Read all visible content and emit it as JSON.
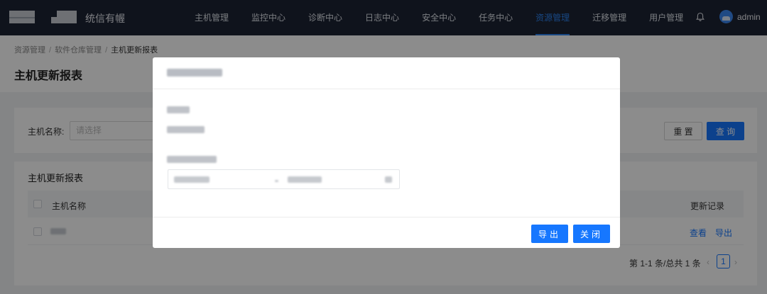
{
  "header": {
    "brand": "统信有幄",
    "nav": [
      "主机管理",
      "监控中心",
      "诊断中心",
      "日志中心",
      "安全中心",
      "任务中心",
      "资源管理",
      "迁移管理",
      "用户管理"
    ],
    "active_nav": "资源管理",
    "user": "admin",
    "accent": "#2d83f0",
    "bg": "#1d2334"
  },
  "breadcrumb": {
    "items": [
      "资源管理",
      "软件仓库管理",
      "主机更新报表"
    ],
    "separator": "/"
  },
  "page": {
    "title": "主机更新报表"
  },
  "search": {
    "name_label": "主机名称:",
    "name_placeholder": "请选择",
    "reset_label": "重 置",
    "query_label": "查 询"
  },
  "table": {
    "title": "主机更新报表",
    "columns": {
      "name": "主机名称",
      "records": "更新记录"
    },
    "rows": [
      {
        "actions": {
          "view": "查看",
          "export": "导出"
        }
      }
    ]
  },
  "pagination": {
    "total": "第 1-1 条/总共 1 条",
    "current_page": "1",
    "prev_icon": "‹",
    "next_icon": "›"
  },
  "modal": {
    "export_label": "导出",
    "close_label": "关闭",
    "primary_color": "#1677ff"
  }
}
